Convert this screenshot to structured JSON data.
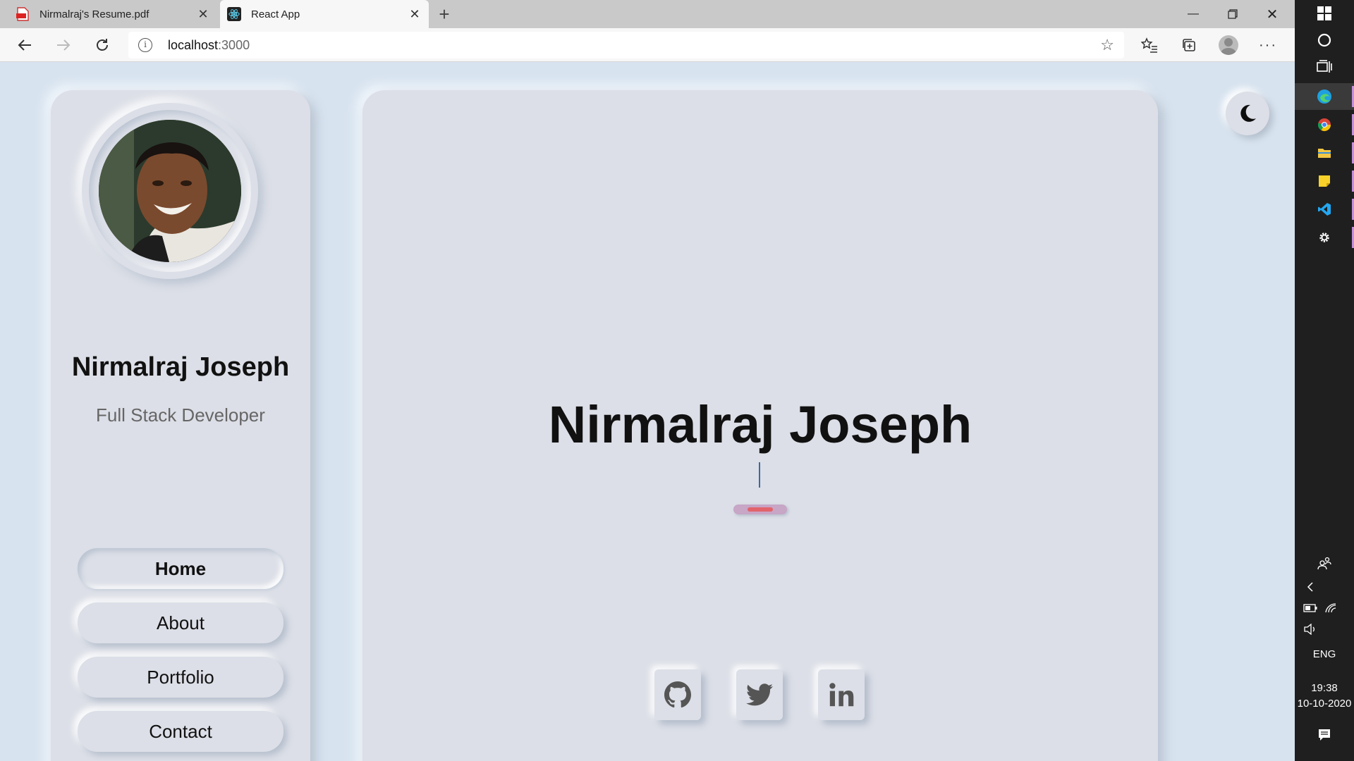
{
  "browser": {
    "tabs": [
      {
        "title": "Nirmalraj's Resume.pdf",
        "icon": "pdf-icon",
        "active": false
      },
      {
        "title": "React App",
        "icon": "react-icon",
        "active": true
      }
    ],
    "address": {
      "host": "localhost",
      "port": ":3000"
    }
  },
  "sidebar": {
    "first_name": "Nirmalraj",
    "last_name": "Joseph",
    "role": "Full Stack Developer",
    "nav": [
      {
        "label": "Home",
        "active": true
      },
      {
        "label": "About",
        "active": false
      },
      {
        "label": "Portfolio",
        "active": false
      },
      {
        "label": "Contact",
        "active": false
      }
    ]
  },
  "hero": {
    "name": "Nirmalraj Joseph",
    "socials": [
      "github-icon",
      "twitter-icon",
      "linkedin-icon"
    ]
  },
  "theme_toggle": {
    "icon": "moon-icon"
  },
  "taskbar": {
    "language": "ENG",
    "time": "19:38",
    "date": "10-10-2020"
  },
  "colors": {
    "accent": "#e2636b",
    "card": "#dcdfe7",
    "background": "#d7e3ef"
  }
}
